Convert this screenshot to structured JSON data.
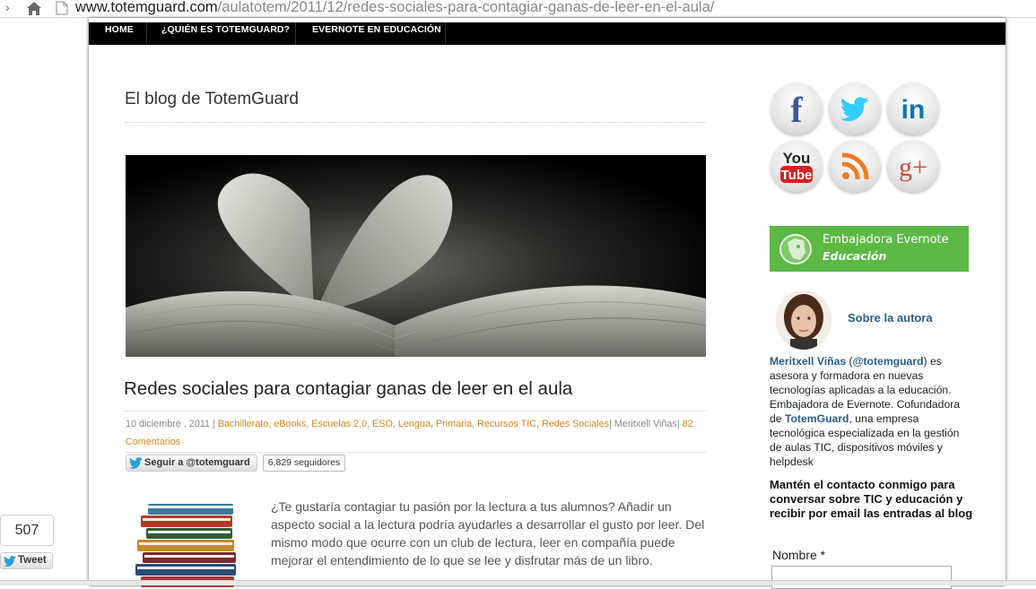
{
  "browser": {
    "url_host": "www.totemguard.com",
    "url_path": "/aulatotem/2011/12/redes-sociales-para-contagiar-ganas-de-leer-en-el-aula/"
  },
  "nav": {
    "items": [
      "HOME",
      "¿QUIÉN ES TOTEMGUARD?",
      "EVERNOTE EN EDUCACIÓN"
    ]
  },
  "blog": {
    "title": "El blog de TotemGuard"
  },
  "post": {
    "title": "Redes sociales para contagiar ganas de leer en el aula",
    "date": "10 diciembre , 2011",
    "categories": [
      "Bachillerato",
      "eBooks",
      "Escuelas 2.0",
      "ESO",
      "Lengua",
      "Primaria",
      "Recursos TIC",
      "Redes Sociales"
    ],
    "author": "Meritxell Viñas",
    "comments": "82 Comentarios",
    "follow_label": "Seguir a @totemguard",
    "follow_count": "6,829 seguidores",
    "intro": "¿Te gustaría contagiar tu pasión por la lectura a tus alumnos? Añadir un aspecto social a la lectura podría ayudarles a desarrollar el gusto por leer. Del mismo modo que ocurre con un club de lectura, leer en compañía puede mejorar el entendimiento de lo que se lee y disfrutar más de un libro."
  },
  "sidebar": {
    "social_icons": [
      "facebook-icon",
      "twitter-icon",
      "linkedin-icon",
      "youtube-icon",
      "rss-icon",
      "google-plus-icon"
    ],
    "evernote_line1": "Embajadora Evernote",
    "evernote_line2": "Educación",
    "about_title": "Sobre la autora",
    "about_name": "Meritxell Viñas",
    "about_handle": "@totemguard",
    "about_text1": "es asesora y formadora en nuevas tecnologías aplicadas a la educación. Embajadora de Evernote. Cofundadora de",
    "about_company": "TotemGuard",
    "about_text2": ", una empresa tecnológica especializada en la gestión de aulas TIC, dispositivos móviles y helpdesk",
    "contact_text": "Mantén el contacto conmigo para conversar sobre TIC y educación y recibir por email las entradas al blog",
    "name_label": "Nombre *"
  },
  "share": {
    "count": "507",
    "tweet_label": "Tweet"
  },
  "colors": {
    "nav_bg": "#000000",
    "link_orange": "#d38a1a",
    "link_blue": "#2a5d8a",
    "evernote_green": "#5bb944"
  }
}
